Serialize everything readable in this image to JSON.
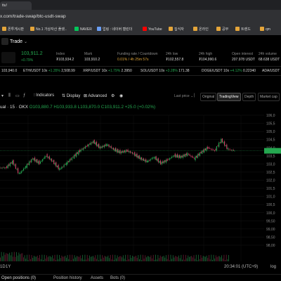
{
  "browser": {
    "tab_title": "ttu! ",
    "url": "x.com/trade-swap/btc-usdt-swap",
    "bookmarks": [
      "폰투게시판",
      "No.1 가상자산 플랫..",
      "NAVER",
      "업링 : 네이버 캘린더",
      "YouTube",
      "집식자",
      "온라인",
      "공부",
      "트렌드",
      "qm"
    ]
  },
  "header": {
    "trade_label": "Trade",
    "pair_price": "103,911.2",
    "pair_change": "+0.79%",
    "stats": [
      {
        "label": "Index",
        "value": "₮103,934.2"
      },
      {
        "label": "Mark",
        "value": "103,910.2"
      },
      {
        "label": "Funding rate / Countdown",
        "value": "0.01% / 4h 25m 57s"
      },
      {
        "label": "24h low",
        "value": "₮102,557.8"
      },
      {
        "label": "24h high",
        "value": "₮104,990.6"
      },
      {
        "label": "Open interest",
        "value": "207.978 USDT"
      },
      {
        "label": "24h volume",
        "value": "68.638 USDT"
      },
      {
        "label": "24h turnover",
        "value": "68,638"
      }
    ]
  },
  "marquee": [
    {
      "left": "103,940.0",
      "pair": "",
      "change": ""
    },
    {
      "pair": "ETH/USDT 10x",
      "change": "+1.35%",
      "price": "2,508.99"
    },
    {
      "pair": "XRP/USDT 10x",
      "change": "+1.79%",
      "price": "2.3950"
    },
    {
      "pair": "SOL/USDT 10x",
      "change": "+3.28%",
      "price": "171.38"
    },
    {
      "pair": "DOGE/USDT 10x",
      "change": "+4.12%",
      "price": "0.22340"
    },
    {
      "pair": "ADA/USDT",
      "change": "",
      "price": ""
    }
  ],
  "toolbar": {
    "indicators": "Indicators",
    "display": "Display",
    "advanced": "Advanced",
    "last_price": "Last price",
    "views": [
      "Original",
      "TradingView",
      "Depth",
      "Market cap"
    ],
    "active_view": "TradingView"
  },
  "chart": {
    "legend_prefix": "ual · 15 · OKX",
    "o": "O103,880.7",
    "h": "H103,933.8",
    "l": "L103,870.0",
    "c": "C103,911.2",
    "change": "+25.0 (+0.02%)"
  },
  "chart_data": {
    "type": "candlestick",
    "title": "",
    "x_ticks": [
      "16",
      "12:00",
      "17",
      "12:00",
      "18",
      "12:00",
      "19"
    ],
    "y_ticks": [
      "106,0",
      "105,5",
      "105,0",
      "104,5",
      "104,0",
      "103,5",
      "103,0",
      "102,5",
      "102,0",
      "101,5",
      "101,0",
      "100,5",
      "100,0",
      "99,50",
      "99,00",
      "98,50",
      "98,00"
    ],
    "ylim": [
      97800,
      106200
    ],
    "volume_label": "Volume",
    "series": [
      {
        "name": "price_segments",
        "values": [
          102800,
          103200,
          102400,
          102900,
          103400,
          103100,
          103600,
          103200,
          102700,
          103100,
          103500,
          103900,
          104200,
          104500,
          104100,
          104300,
          104000,
          103800,
          103900,
          103700,
          103400,
          103200,
          103500,
          103100,
          103300,
          103600,
          103500,
          103700,
          103400,
          103800,
          104100,
          103900,
          104600,
          104000,
          103900
        ]
      }
    ]
  },
  "footer": {
    "timeframes": [
      "1D",
      "1Y"
    ],
    "clock": "20:34:01 (UTC+9)",
    "scale": "log",
    "bottom_tabs": [
      "Open positions (0)",
      "Position history",
      "Assets",
      "Bots (0)"
    ]
  },
  "colors": {
    "up": "#25a750",
    "down": "#ca3f64",
    "bg": "#000000"
  }
}
